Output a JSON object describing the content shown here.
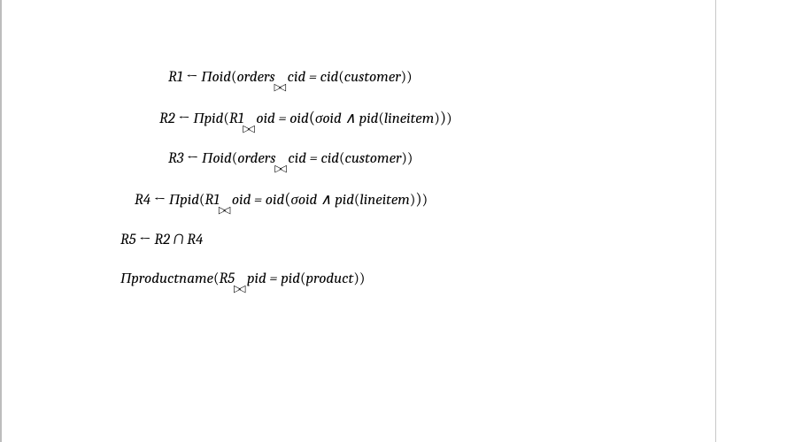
{
  "equations": {
    "line1": {
      "lhs": "R1",
      "arrow": "←",
      "proj": "Πoid",
      "lrel": "orders",
      "cond": "cid = cid",
      "rrel": "customer"
    },
    "line2": {
      "lhs": "R2",
      "arrow": "←",
      "proj": "Πpid",
      "lrel": "R1",
      "cond1": "oid = oid",
      "sigma": "σoid ∧ pid",
      "rrel": "lineitem"
    },
    "line3": {
      "lhs": "R3",
      "arrow": "←",
      "proj": "Πoid",
      "lrel": "orders",
      "cond": "cid = cid",
      "rrel": "customer"
    },
    "line4": {
      "lhs": "R4",
      "arrow": "←",
      "proj": "Πpid",
      "lrel": "R1",
      "cond1": "oid = oid",
      "sigma": "σoid ∧ pid",
      "rrel": "lineitem"
    },
    "line5": {
      "lhs": "R5",
      "arrow": "←",
      "rhs": "R2 ∩ R4"
    },
    "line6": {
      "proj": "Πproductname",
      "lrel": "R5",
      "cond": "pid = pid",
      "rrel": "product"
    }
  }
}
